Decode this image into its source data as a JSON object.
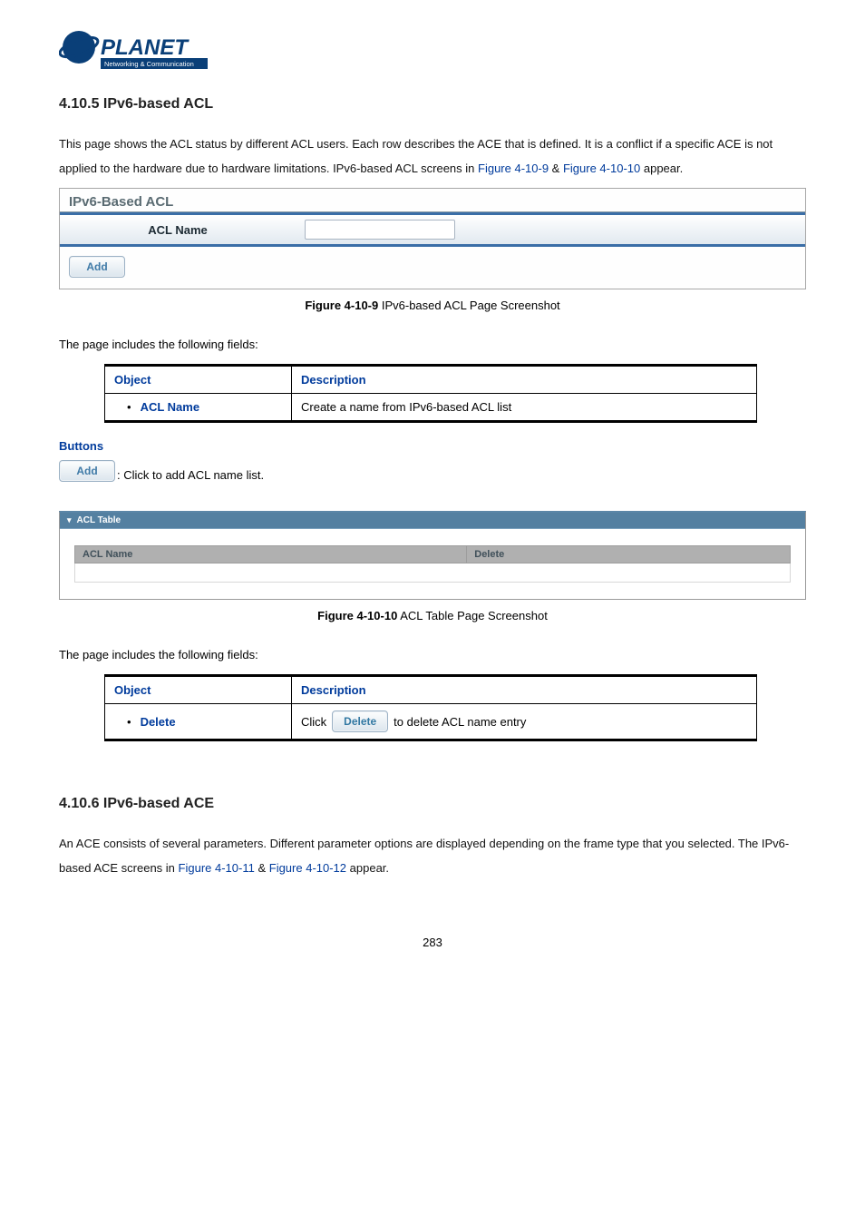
{
  "logo": {
    "brand": "PLANET",
    "tagline": "Networking & Communication"
  },
  "section1": {
    "heading": "4.10.5 IPv6-based ACL",
    "para_a": "This page shows the ACL status by different ACL users. Each row describes the ACE that is defined. It is a conflict if a specific ACE is not applied to the hardware due to hardware limitations. IPv6-based ACL screens in ",
    "link1": "Figure 4-10-9",
    "amp": " & ",
    "link2": "Figure 4-10-10",
    "para_b": " appear."
  },
  "shot1": {
    "panel_title": "IPv6-Based ACL",
    "field_label": "ACL Name",
    "input_value": "",
    "add_btn": "Add",
    "caption_b": "Figure 4-10-9",
    "caption_rest": " IPv6-based ACL Page Screenshot"
  },
  "fields_intro": "The page includes the following fields:",
  "table1": {
    "h1": "Object",
    "h2": "Description",
    "r1c1": "ACL Name",
    "r1c2": "Create a name from IPv6-based ACL list"
  },
  "buttons_head": "Buttons",
  "btn_desc1": {
    "btn": "Add",
    "text": ": Click to add ACL name list."
  },
  "shot2": {
    "tab": "ACL Table",
    "col1": "ACL Name",
    "col2": "Delete",
    "caption_b": "Figure 4-10-10",
    "caption_rest": " ACL Table Page Screenshot"
  },
  "table2": {
    "h1": "Object",
    "h2": "Description",
    "r1c1": "Delete",
    "pre": "Click ",
    "btn": "Delete",
    "post": " to delete ACL name entry"
  },
  "section2": {
    "heading": "4.10.6 IPv6-based ACE",
    "para_a": "An ACE consists of several parameters. Different parameter options are displayed depending on the frame type that you selected. The IPv6-based ACE screens in ",
    "link1": "Figure 4-10-11",
    "amp": " & ",
    "link2": "Figure 4-10-12",
    "para_b": " appear."
  },
  "page_no": "283"
}
